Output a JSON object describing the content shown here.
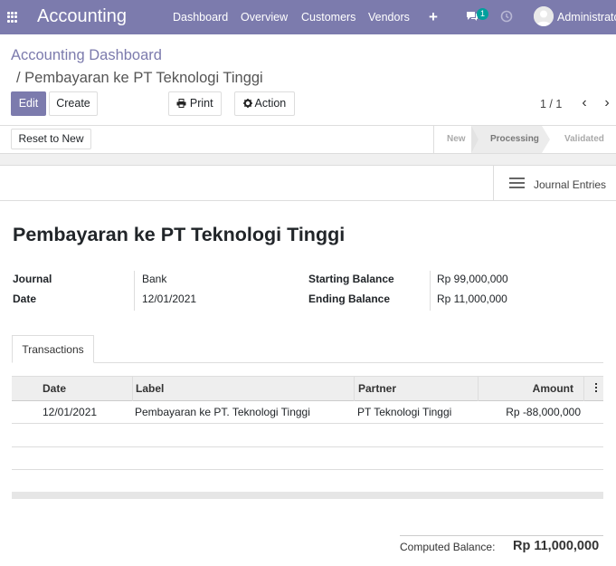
{
  "navbar": {
    "app_name": "Accounting",
    "menu": [
      "Dashboard",
      "Overview",
      "Customers",
      "Vendors"
    ],
    "plus_icon": "+",
    "chat_count": "1",
    "user_name": "Administrator"
  },
  "breadcrumb": {
    "root": "Accounting Dashboard",
    "current": "/ Pembayaran ke PT Teknologi Tinggi"
  },
  "toolbar": {
    "edit_label": "Edit",
    "create_label": "Create",
    "print_label": "Print",
    "action_label": "Action"
  },
  "pager": {
    "text": "1 / 1"
  },
  "statusbar": {
    "reset_label": "Reset to New",
    "stages": [
      "New",
      "Processing",
      "Validated"
    ],
    "active_stage": "Processing"
  },
  "smart_button": {
    "label": "Journal Entries"
  },
  "record": {
    "title": "Pembayaran ke PT Teknologi Tinggi",
    "journal_label": "Journal",
    "journal_value": "Bank",
    "date_label": "Date",
    "date_value": "12/01/2021",
    "starting_balance_label": "Starting Balance",
    "starting_balance_value": "Rp 99,000,000",
    "ending_balance_label": "Ending Balance",
    "ending_balance_value": "Rp 11,000,000"
  },
  "tabs": [
    "Transactions"
  ],
  "table": {
    "columns": [
      "Date",
      "Label",
      "Partner",
      "Amount"
    ],
    "rows": [
      {
        "date": "12/01/2021",
        "label": "Pembayaran ke PT. Teknologi Tinggi",
        "partner": "PT Teknologi Tinggi",
        "amount": "Rp -88,000,000"
      }
    ]
  },
  "totals": {
    "computed_balance_label": "Computed Balance:",
    "computed_balance_value": "Rp 11,000,000"
  },
  "colors": {
    "brand": "#7c7bad",
    "badge": "#00a09d"
  }
}
